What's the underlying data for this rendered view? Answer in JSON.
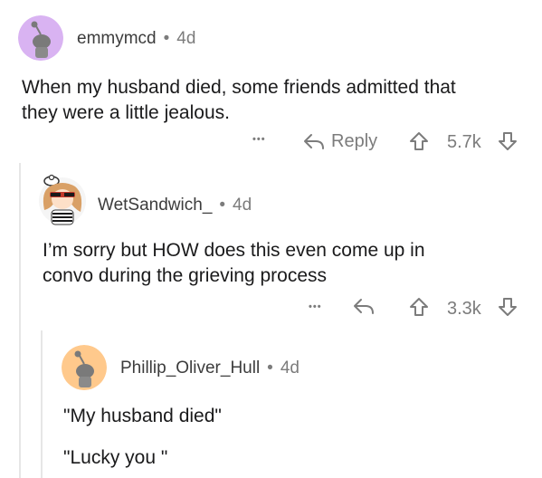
{
  "comments": [
    {
      "username": "emmymcd",
      "separator": "•",
      "age": "4d",
      "text_lines": [
        "When my husband died, some friends admitted that",
        "they were a little jealous."
      ],
      "more": "•••",
      "reply_label": "Reply",
      "score": "5.7k",
      "avatar_color": "#d9b3f2"
    },
    {
      "username": "WetSandwich_",
      "separator": "•",
      "age": "4d",
      "text_lines": [
        "I’m sorry but HOW does this even come up in",
        "convo during the grieving process"
      ],
      "more": "•••",
      "score": "3.3k"
    },
    {
      "username": "Phillip_Oliver_Hull",
      "separator": "•",
      "age": "4d",
      "text_lines": [
        "\"My husband died\"",
        "\"Lucky you \""
      ],
      "avatar_color": "#ffc98c"
    }
  ],
  "colors": {
    "muted": "#7c7c7c",
    "thread_line": "#e6e6e6"
  }
}
